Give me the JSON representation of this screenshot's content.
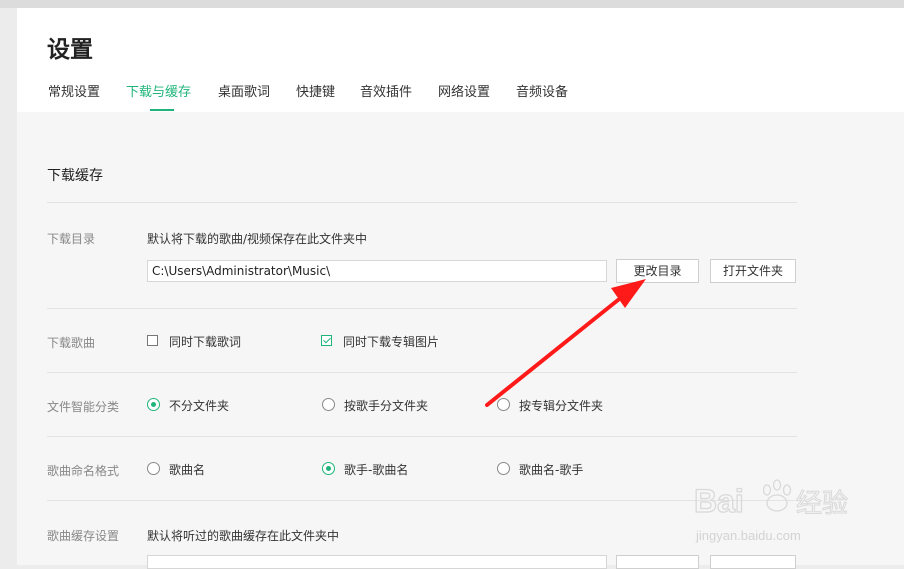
{
  "header": {
    "title": "设置",
    "tabs": [
      {
        "label": "常规设置"
      },
      {
        "label": "下载与缓存"
      },
      {
        "label": "桌面歌词"
      },
      {
        "label": "快捷键"
      },
      {
        "label": "音效插件"
      },
      {
        "label": "网络设置"
      },
      {
        "label": "音频设备"
      }
    ],
    "active_tab": "下载与缓存"
  },
  "section": {
    "title": "下载缓存",
    "download_dir": {
      "label": "下载目录",
      "description": "默认将下载的歌曲/视频保存在此文件夹中",
      "path_value": "C:\\Users\\Administrator\\Music\\",
      "change_button": "更改目录",
      "open_button": "打开文件夹"
    },
    "download_song": {
      "label": "下载歌曲",
      "options": [
        {
          "label": "同时下载歌词",
          "checked": false
        },
        {
          "label": "同时下载专辑图片",
          "checked": true
        }
      ]
    },
    "smart_classify": {
      "label": "文件智能分类",
      "options": [
        {
          "label": "不分文件夹",
          "selected": true
        },
        {
          "label": "按歌手分文件夹",
          "selected": false
        },
        {
          "label": "按专辑分文件夹",
          "selected": false
        }
      ]
    },
    "naming_format": {
      "label": "歌曲命名格式",
      "options": [
        {
          "label": "歌曲名",
          "selected": false
        },
        {
          "label": "歌手-歌曲名",
          "selected": true
        },
        {
          "label": "歌曲名-歌手",
          "selected": false
        }
      ]
    },
    "cache_settings": {
      "label": "歌曲缓存设置",
      "description": "默认将听过的歌曲缓存在此文件夹中"
    }
  },
  "watermark": {
    "brand": "Bai",
    "brand_suffix": "经验",
    "url": "jingyan.baidu.com"
  },
  "colors": {
    "accent": "#1fb57a",
    "annotation_arrow": "#ff1a1a"
  }
}
